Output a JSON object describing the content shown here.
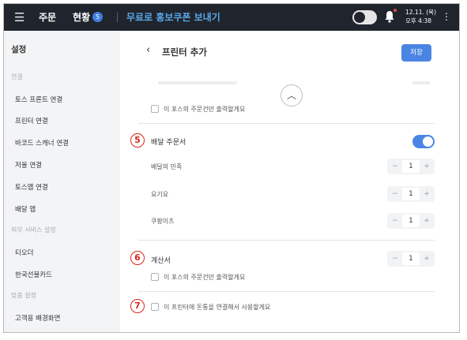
{
  "topbar": {
    "menu_icon": "hamburger-icon",
    "orders_label": "주문",
    "status_label": "현황",
    "status_badge": "5",
    "coupon_label": "무료로 홍보쿠폰 보내기",
    "date": "12.11. (목)",
    "time": "오후 4:38",
    "notification_icon": "bell-icon",
    "more_icon": "kebab-icon"
  },
  "sidebar": {
    "title": "설정",
    "groups": [
      {
        "label": "연결",
        "items": [
          "토스 프론트 연결",
          "프린터 연결",
          "바코드 스캐너 연결",
          "저울 연결",
          "토스앱 연결",
          "배달 앱"
        ]
      },
      {
        "label": "외부 서비스 설정",
        "items": [
          "티오더",
          "한국선불카드"
        ]
      },
      {
        "label": "맞춤 설정",
        "items": [
          "고객용 배경화면"
        ]
      }
    ]
  },
  "page": {
    "back_icon": "chevron-left-icon",
    "title": "프린터 추가",
    "save_label": "저장",
    "collapse_icon": "chevron-up-icon",
    "top_checkbox_label": "이 포스의 주문건만 출력할게요",
    "delivery": {
      "marker": "5",
      "title": "배달 주문서",
      "toggle_on": true,
      "rows": [
        {
          "label": "배달의 민족",
          "value": "1"
        },
        {
          "label": "요기요",
          "value": "1"
        },
        {
          "label": "쿠팡이츠",
          "value": "1"
        }
      ]
    },
    "receipt": {
      "marker": "6",
      "title": "계산서",
      "value": "1",
      "checkbox_label": "이 포스의 주문건만 출력할게요"
    },
    "cashdrawer": {
      "marker": "7",
      "checkbox_label": "이 프린터에 돈통을 연결해서 사용할게요"
    },
    "stepper_minus": "−",
    "stepper_plus": "+"
  },
  "colors": {
    "topbar_bg": "#20242d",
    "accent": "#4a85e4",
    "coupon_text": "#5aa7e8",
    "marker_red": "#d9261c",
    "sidebar_bg": "#f3f4f6"
  }
}
